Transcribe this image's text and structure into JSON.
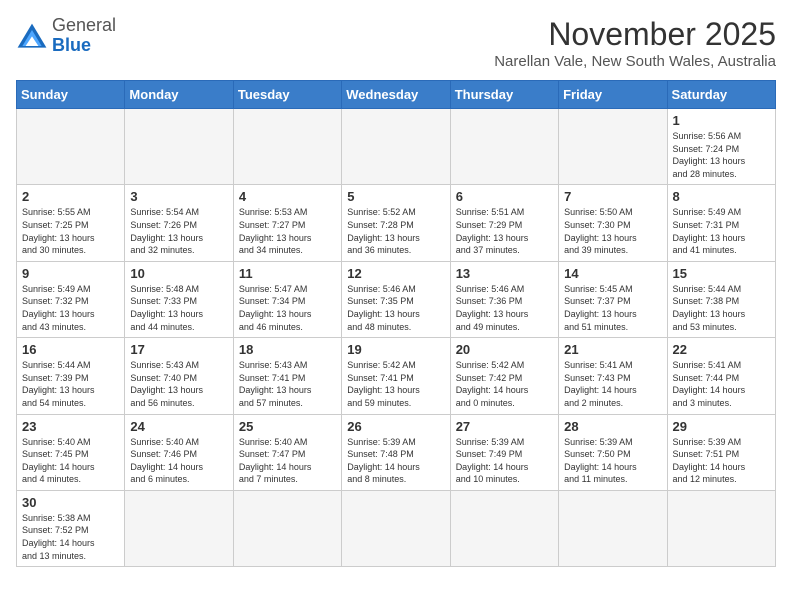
{
  "header": {
    "logo_general": "General",
    "logo_blue": "Blue",
    "month_title": "November 2025",
    "location": "Narellan Vale, New South Wales, Australia"
  },
  "days_of_week": [
    "Sunday",
    "Monday",
    "Tuesday",
    "Wednesday",
    "Thursday",
    "Friday",
    "Saturday"
  ],
  "weeks": [
    [
      {
        "day": "",
        "info": ""
      },
      {
        "day": "",
        "info": ""
      },
      {
        "day": "",
        "info": ""
      },
      {
        "day": "",
        "info": ""
      },
      {
        "day": "",
        "info": ""
      },
      {
        "day": "",
        "info": ""
      },
      {
        "day": "1",
        "info": "Sunrise: 5:56 AM\nSunset: 7:24 PM\nDaylight: 13 hours\nand 28 minutes."
      }
    ],
    [
      {
        "day": "2",
        "info": "Sunrise: 5:55 AM\nSunset: 7:25 PM\nDaylight: 13 hours\nand 30 minutes."
      },
      {
        "day": "3",
        "info": "Sunrise: 5:54 AM\nSunset: 7:26 PM\nDaylight: 13 hours\nand 32 minutes."
      },
      {
        "day": "4",
        "info": "Sunrise: 5:53 AM\nSunset: 7:27 PM\nDaylight: 13 hours\nand 34 minutes."
      },
      {
        "day": "5",
        "info": "Sunrise: 5:52 AM\nSunset: 7:28 PM\nDaylight: 13 hours\nand 36 minutes."
      },
      {
        "day": "6",
        "info": "Sunrise: 5:51 AM\nSunset: 7:29 PM\nDaylight: 13 hours\nand 37 minutes."
      },
      {
        "day": "7",
        "info": "Sunrise: 5:50 AM\nSunset: 7:30 PM\nDaylight: 13 hours\nand 39 minutes."
      },
      {
        "day": "8",
        "info": "Sunrise: 5:49 AM\nSunset: 7:31 PM\nDaylight: 13 hours\nand 41 minutes."
      }
    ],
    [
      {
        "day": "9",
        "info": "Sunrise: 5:49 AM\nSunset: 7:32 PM\nDaylight: 13 hours\nand 43 minutes."
      },
      {
        "day": "10",
        "info": "Sunrise: 5:48 AM\nSunset: 7:33 PM\nDaylight: 13 hours\nand 44 minutes."
      },
      {
        "day": "11",
        "info": "Sunrise: 5:47 AM\nSunset: 7:34 PM\nDaylight: 13 hours\nand 46 minutes."
      },
      {
        "day": "12",
        "info": "Sunrise: 5:46 AM\nSunset: 7:35 PM\nDaylight: 13 hours\nand 48 minutes."
      },
      {
        "day": "13",
        "info": "Sunrise: 5:46 AM\nSunset: 7:36 PM\nDaylight: 13 hours\nand 49 minutes."
      },
      {
        "day": "14",
        "info": "Sunrise: 5:45 AM\nSunset: 7:37 PM\nDaylight: 13 hours\nand 51 minutes."
      },
      {
        "day": "15",
        "info": "Sunrise: 5:44 AM\nSunset: 7:38 PM\nDaylight: 13 hours\nand 53 minutes."
      }
    ],
    [
      {
        "day": "16",
        "info": "Sunrise: 5:44 AM\nSunset: 7:39 PM\nDaylight: 13 hours\nand 54 minutes."
      },
      {
        "day": "17",
        "info": "Sunrise: 5:43 AM\nSunset: 7:40 PM\nDaylight: 13 hours\nand 56 minutes."
      },
      {
        "day": "18",
        "info": "Sunrise: 5:43 AM\nSunset: 7:41 PM\nDaylight: 13 hours\nand 57 minutes."
      },
      {
        "day": "19",
        "info": "Sunrise: 5:42 AM\nSunset: 7:41 PM\nDaylight: 13 hours\nand 59 minutes."
      },
      {
        "day": "20",
        "info": "Sunrise: 5:42 AM\nSunset: 7:42 PM\nDaylight: 14 hours\nand 0 minutes."
      },
      {
        "day": "21",
        "info": "Sunrise: 5:41 AM\nSunset: 7:43 PM\nDaylight: 14 hours\nand 2 minutes."
      },
      {
        "day": "22",
        "info": "Sunrise: 5:41 AM\nSunset: 7:44 PM\nDaylight: 14 hours\nand 3 minutes."
      }
    ],
    [
      {
        "day": "23",
        "info": "Sunrise: 5:40 AM\nSunset: 7:45 PM\nDaylight: 14 hours\nand 4 minutes."
      },
      {
        "day": "24",
        "info": "Sunrise: 5:40 AM\nSunset: 7:46 PM\nDaylight: 14 hours\nand 6 minutes."
      },
      {
        "day": "25",
        "info": "Sunrise: 5:40 AM\nSunset: 7:47 PM\nDaylight: 14 hours\nand 7 minutes."
      },
      {
        "day": "26",
        "info": "Sunrise: 5:39 AM\nSunset: 7:48 PM\nDaylight: 14 hours\nand 8 minutes."
      },
      {
        "day": "27",
        "info": "Sunrise: 5:39 AM\nSunset: 7:49 PM\nDaylight: 14 hours\nand 10 minutes."
      },
      {
        "day": "28",
        "info": "Sunrise: 5:39 AM\nSunset: 7:50 PM\nDaylight: 14 hours\nand 11 minutes."
      },
      {
        "day": "29",
        "info": "Sunrise: 5:39 AM\nSunset: 7:51 PM\nDaylight: 14 hours\nand 12 minutes."
      }
    ],
    [
      {
        "day": "30",
        "info": "Sunrise: 5:38 AM\nSunset: 7:52 PM\nDaylight: 14 hours\nand 13 minutes."
      },
      {
        "day": "",
        "info": ""
      },
      {
        "day": "",
        "info": ""
      },
      {
        "day": "",
        "info": ""
      },
      {
        "day": "",
        "info": ""
      },
      {
        "day": "",
        "info": ""
      },
      {
        "day": "",
        "info": ""
      }
    ]
  ]
}
